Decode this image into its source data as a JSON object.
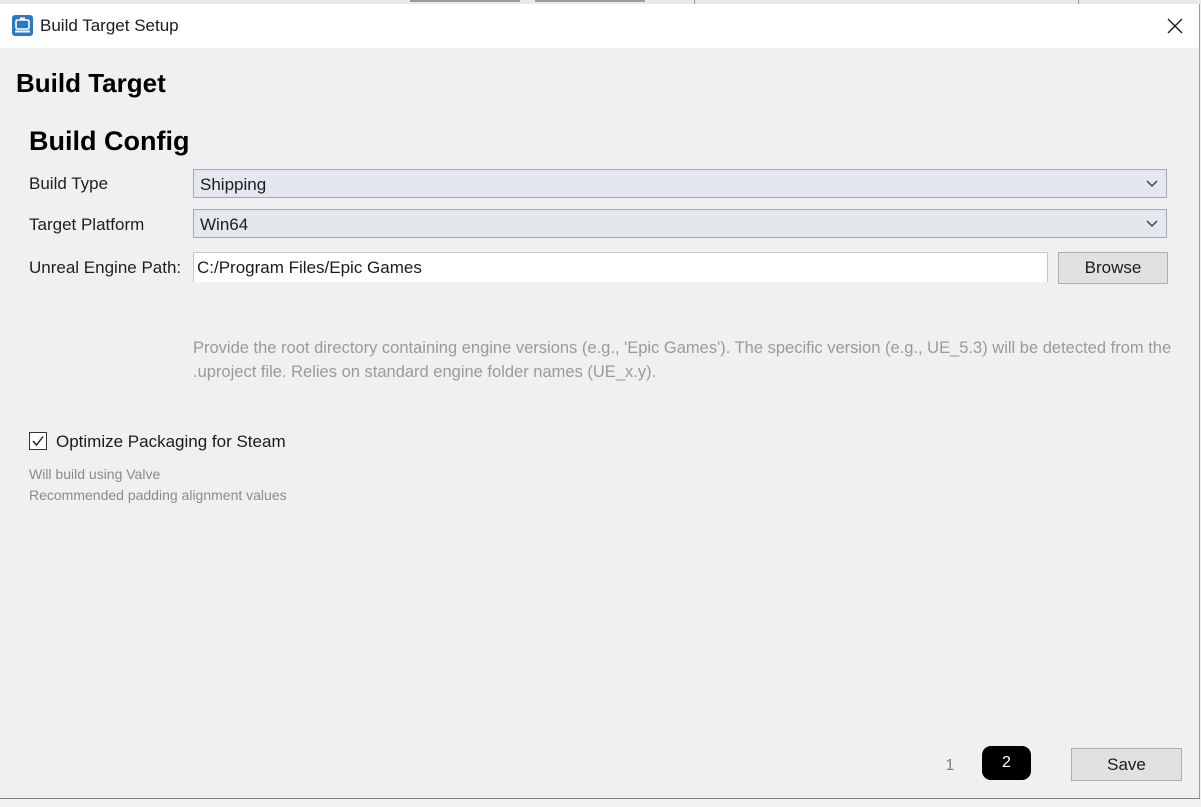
{
  "window": {
    "title": "Build Target Setup",
    "app_icon": "app-icon",
    "close_icon": "close-icon"
  },
  "page": {
    "title": "Build Target"
  },
  "build_config": {
    "section_title": "Build Config",
    "build_type": {
      "label": "Build Type",
      "value": "Shipping"
    },
    "target_platform": {
      "label": "Target Platform",
      "value": "Win64"
    },
    "engine_path": {
      "label": "Unreal Engine Path:",
      "value": "C:/Program Files/Epic Games",
      "browse_label": "Browse",
      "hint": "Provide the root directory containing engine versions (e.g., 'Epic Games'). The specific version (e.g., UE_5.3) will be detected from the .uproject file. Relies on standard engine folder names (UE_x.y)."
    }
  },
  "steam": {
    "checkbox_label": "Optimize Packaging for Steam",
    "checked": true,
    "note_line1": "Will build using Valve",
    "note_line2": "Recommended padding alignment values"
  },
  "footer": {
    "pages": [
      "1",
      "2"
    ],
    "current_page": "2",
    "save_label": "Save"
  },
  "colors": {
    "title_bar": "#ffffff",
    "window_bg": "#f0f0f0",
    "combo_bg": "#e4e7ed",
    "combo_border": "#9da7b6",
    "hint_text": "#9a9a9a",
    "page_current_bg": "#000000",
    "app_icon": "#2b78c6"
  }
}
